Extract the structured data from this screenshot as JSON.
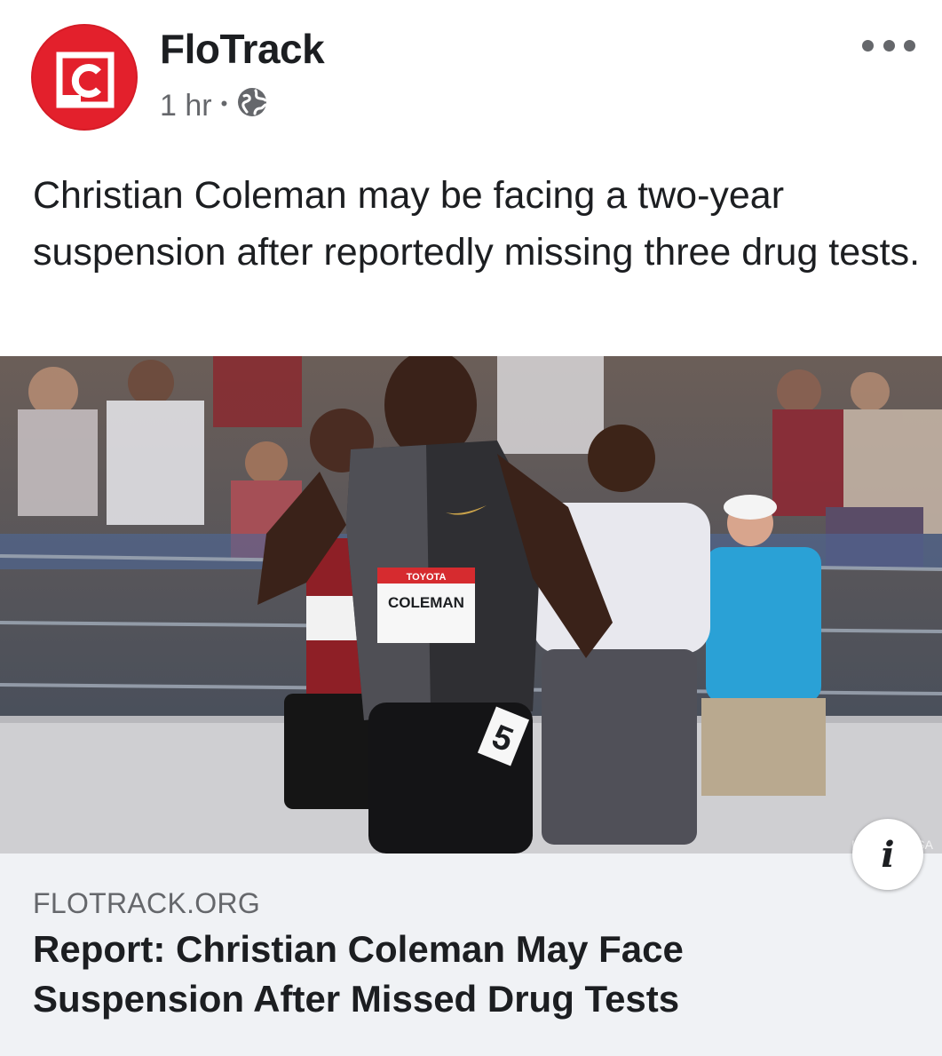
{
  "post": {
    "page_name": "FloTrack",
    "timestamp": "1 hr",
    "separator": "•",
    "audience_icon": "globe-icon",
    "more_icon": "more-horizontal-icon",
    "text": "Christian Coleman may be facing a two-year suspension after reportedly missing three drug tests."
  },
  "photo": {
    "description_icon": "sprinter-photo",
    "bib_sponsor": "TOYOTA",
    "bib_name": "COLEMAN",
    "lane_number": "5",
    "credit": "Kirby Lee/USA"
  },
  "link": {
    "domain": "FLOTRACK.ORG",
    "title": "Report: Christian Coleman May Face Suspension After Missed Drug Tests",
    "info_icon": "info-icon",
    "info_glyph": "i"
  },
  "colors": {
    "brand_red": "#e3202c",
    "card_bg": "#f0f2f5",
    "secondary_text": "#65676b",
    "primary_text": "#1c1e21"
  }
}
